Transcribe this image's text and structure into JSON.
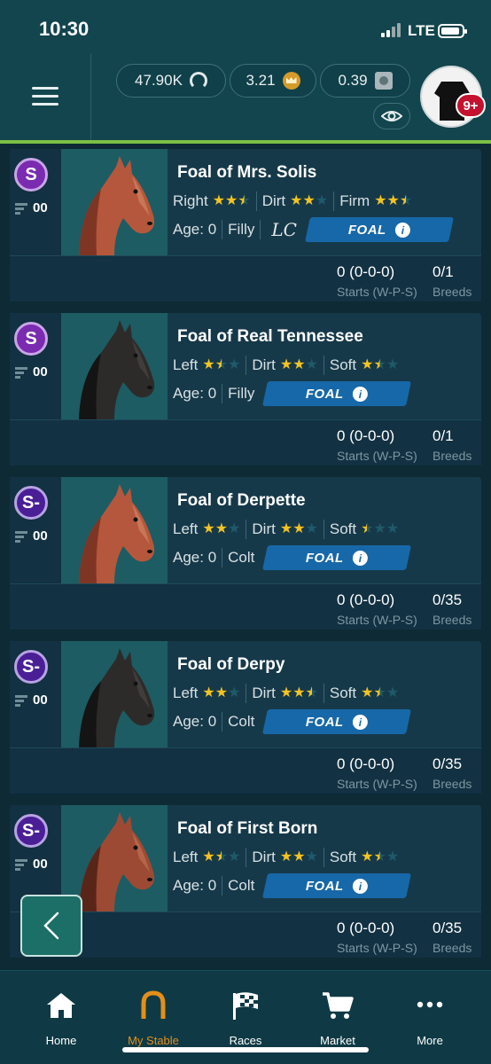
{
  "status_bar": {
    "time": "10:30",
    "network": "LTE"
  },
  "header": {
    "currency_1": "47.90K",
    "currency_2": "3.21",
    "currency_3": "0.39",
    "notification_count": "9+"
  },
  "horses": [
    {
      "name": "Foal of Mrs. Solis",
      "grade": "S",
      "speed": "00",
      "surfaces": [
        {
          "label": "Right",
          "stars": 2.5
        },
        {
          "label": "Dirt",
          "stars": 2
        },
        {
          "label": "Firm",
          "stars": 2.5
        }
      ],
      "age": "Age: 0",
      "sex": "Filly",
      "has_signature": true,
      "signature": "LC",
      "foal_label": "FOAL",
      "starts_value": "0 (0-0-0)",
      "starts_label": "Starts (W-P-S)",
      "breeds_value": "0/1",
      "breeds_label": "Breeds",
      "coat": "chestnut"
    },
    {
      "name": "Foal of Real Tennessee",
      "grade": "S",
      "speed": "00",
      "surfaces": [
        {
          "label": "Left",
          "stars": 1.5
        },
        {
          "label": "Dirt",
          "stars": 2
        },
        {
          "label": "Soft",
          "stars": 1.5
        }
      ],
      "age": "Age: 0",
      "sex": "Filly",
      "has_signature": false,
      "signature": "",
      "foal_label": "FOAL",
      "starts_value": "0 (0-0-0)",
      "starts_label": "Starts (W-P-S)",
      "breeds_value": "0/1",
      "breeds_label": "Breeds",
      "coat": "black"
    },
    {
      "name": "Foal of Derpette",
      "grade": "S-",
      "speed": "00",
      "surfaces": [
        {
          "label": "Left",
          "stars": 2
        },
        {
          "label": "Dirt",
          "stars": 2
        },
        {
          "label": "Soft",
          "stars": 0.5
        }
      ],
      "age": "Age: 0",
      "sex": "Colt",
      "has_signature": false,
      "signature": "",
      "foal_label": "FOAL",
      "starts_value": "0 (0-0-0)",
      "starts_label": "Starts (W-P-S)",
      "breeds_value": "0/35",
      "breeds_label": "Breeds",
      "coat": "chestnut"
    },
    {
      "name": "Foal of Derpy",
      "grade": "S-",
      "speed": "00",
      "surfaces": [
        {
          "label": "Left",
          "stars": 2
        },
        {
          "label": "Dirt",
          "stars": 2.5
        },
        {
          "label": "Soft",
          "stars": 1.5
        }
      ],
      "age": "Age: 0",
      "sex": "Colt",
      "has_signature": false,
      "signature": "",
      "foal_label": "FOAL",
      "starts_value": "0 (0-0-0)",
      "starts_label": "Starts (W-P-S)",
      "breeds_value": "0/35",
      "breeds_label": "Breeds",
      "coat": "black"
    },
    {
      "name": "Foal of First Born",
      "grade": "S-",
      "speed": "00",
      "surfaces": [
        {
          "label": "Left",
          "stars": 1.5
        },
        {
          "label": "Dirt",
          "stars": 2
        },
        {
          "label": "Soft",
          "stars": 1.5
        }
      ],
      "age": "Age: 0",
      "sex": "Colt",
      "has_signature": false,
      "signature": "",
      "foal_label": "FOAL",
      "starts_value": "0 (0-0-0)",
      "starts_label": "Starts (W-P-S)",
      "breeds_value": "0/35",
      "breeds_label": "Breeds",
      "coat": "bay"
    }
  ],
  "tabbar": {
    "tabs": [
      {
        "label": "Home",
        "icon": "home-icon",
        "active": false
      },
      {
        "label": "My Stable",
        "icon": "horseshoe-icon",
        "active": true
      },
      {
        "label": "Races",
        "icon": "checkered-flag-icon",
        "active": false
      },
      {
        "label": "Market",
        "icon": "cart-icon",
        "active": false
      },
      {
        "label": "More",
        "icon": "more-icon",
        "active": false
      }
    ]
  },
  "colors": {
    "accent_green": "#7bc043",
    "active_tab": "#e38f1a",
    "foal_button": "#1768a8",
    "star": "#f4c321",
    "notification": "#c4122f"
  }
}
